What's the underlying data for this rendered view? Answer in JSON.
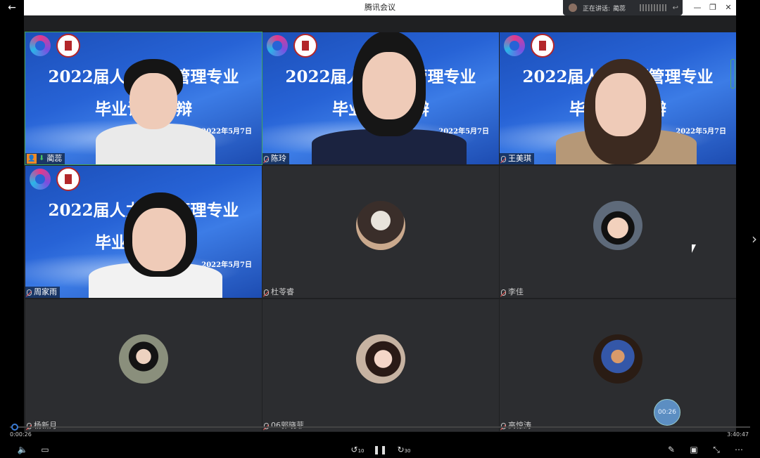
{
  "window": {
    "title": "腾讯会议",
    "controls": {
      "minimize": "—",
      "restore": "❐",
      "close": "✕"
    }
  },
  "speaking": {
    "prefix": "正在讲话:",
    "name": "蔺蕊",
    "reply_icon": "↩"
  },
  "slide": {
    "line1": "2022届人力资源管理专业",
    "line2": "毕业论文答辩",
    "date": "2022年5月7日"
  },
  "participants": [
    {
      "name": "蔺蕊",
      "mode": "video"
    },
    {
      "name": "陈玲",
      "mode": "video"
    },
    {
      "name": "王美琪",
      "mode": "video"
    },
    {
      "name": "周家雨",
      "mode": "video"
    },
    {
      "name": "杜苓睿",
      "mode": "avatar"
    },
    {
      "name": "李佳",
      "mode": "avatar"
    },
    {
      "name": "杨新月",
      "mode": "avatar"
    },
    {
      "name": "06郭晓菲",
      "mode": "avatar"
    },
    {
      "name": "高惊涛",
      "mode": "avatar"
    }
  ],
  "player": {
    "elapsed": "0:00:26",
    "total": "3:40:47",
    "progress": 0.002,
    "bubble_time": "00:26",
    "rewind_label": "10",
    "forward_label": "30"
  },
  "icons": [
    "back-arrow-icon",
    "volume-icon",
    "subtitle-icon",
    "rewind-icon",
    "pause-icon",
    "forward-icon",
    "pen-icon",
    "pip-icon",
    "shrink-icon",
    "more-icon"
  ]
}
